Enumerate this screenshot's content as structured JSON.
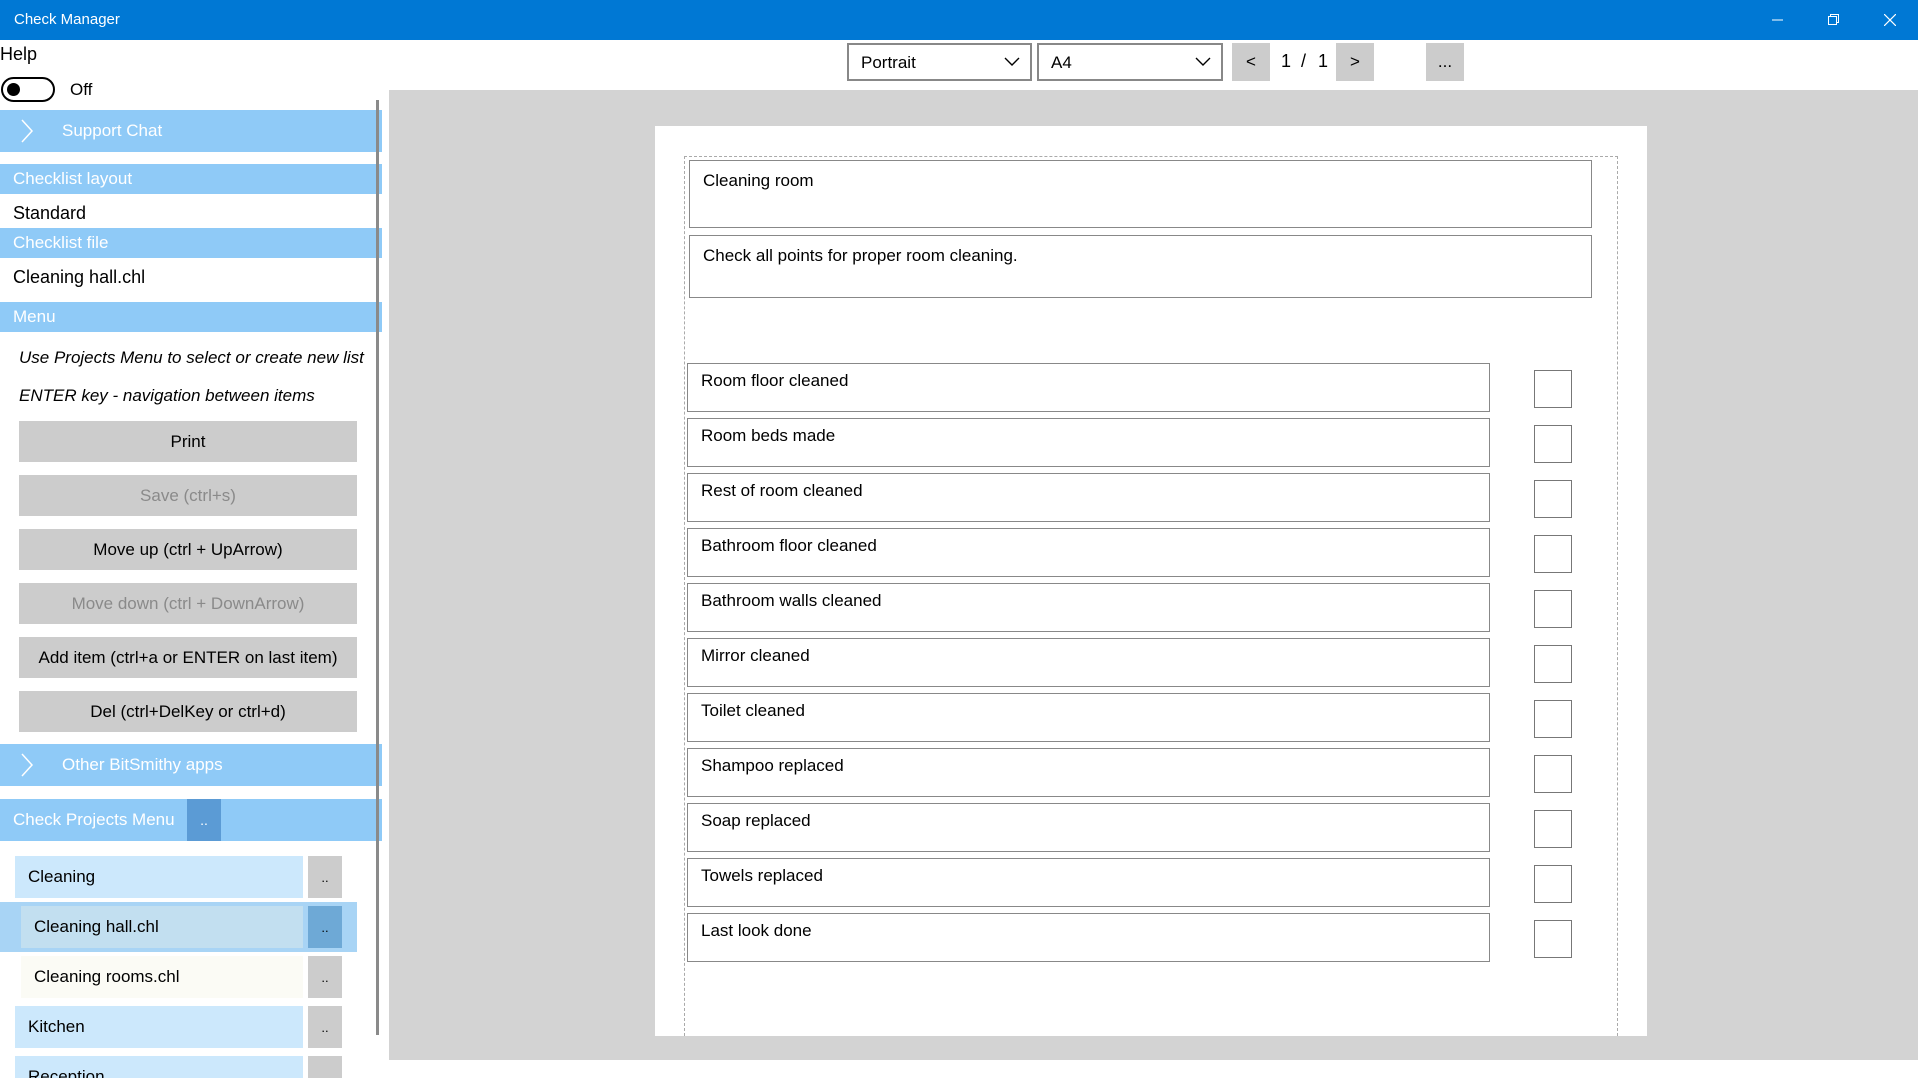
{
  "window": {
    "title": "Check Manager"
  },
  "left_panel": {
    "help_label": "Help",
    "help_toggle": {
      "state_label": "Off",
      "on": false
    },
    "support_chat_label": "Support Chat",
    "checklist_layout": {
      "header": "Checklist layout",
      "value": "Standard"
    },
    "checklist_file": {
      "header": "Checklist file",
      "value": "Cleaning hall.chl"
    },
    "menu": {
      "header": "Menu",
      "notes": [
        "Use Projects Menu to select or create new list",
        "ENTER key - navigation between items"
      ],
      "buttons": [
        {
          "label": "Print",
          "enabled": true
        },
        {
          "label": "Save (ctrl+s)",
          "enabled": false
        },
        {
          "label": "Move up (ctrl + UpArrow)",
          "enabled": true
        },
        {
          "label": "Move down (ctrl + DownArrow)",
          "enabled": false
        },
        {
          "label": "Add item (ctrl+a or ENTER on last item)",
          "enabled": true
        },
        {
          "label": "Del (ctrl+DelKey or ctrl+d)",
          "enabled": true
        }
      ]
    },
    "other_apps_label": "Other BitSmithy apps",
    "projects_menu": {
      "header": "Check Projects Menu",
      "dots": "..",
      "items": [
        {
          "label": "Cleaning",
          "dots": "..",
          "kind": "folder"
        },
        {
          "label": "Cleaning hall.chl",
          "dots": "..",
          "kind": "file",
          "selected": true
        },
        {
          "label": "Cleaning rooms.chl",
          "dots": "..",
          "kind": "file"
        },
        {
          "label": "Kitchen",
          "dots": "..",
          "kind": "folder"
        },
        {
          "label": "Reception",
          "dots": "..",
          "kind": "folder"
        }
      ]
    }
  },
  "toolbar": {
    "orientation": "Portrait",
    "paper_size": "A4",
    "prev_label": "<",
    "next_label": ">",
    "current_page": "1",
    "separator": "/",
    "total_pages": "1",
    "more_label": "..."
  },
  "checklist": {
    "title": "Cleaning room",
    "description": "Check all points for proper room cleaning.",
    "items": [
      {
        "text": "Room floor cleaned",
        "checked": false
      },
      {
        "text": "Room beds made",
        "checked": false
      },
      {
        "text": "Rest of room cleaned",
        "checked": false
      },
      {
        "text": "Bathroom floor cleaned",
        "checked": false
      },
      {
        "text": "Bathroom walls cleaned",
        "checked": false
      },
      {
        "text": "Mirror cleaned",
        "checked": false
      },
      {
        "text": "Toilet cleaned",
        "checked": false
      },
      {
        "text": "Shampoo replaced",
        "checked": false
      },
      {
        "text": "Soap replaced",
        "checked": false
      },
      {
        "text": "Towels replaced",
        "checked": false
      },
      {
        "text": "Last look done",
        "checked": false
      }
    ]
  },
  "colors": {
    "titlebar": "#0078d4",
    "band": "#8fcaf7",
    "selected_row": "#a8d4f5",
    "folder_row": "#cce8fc"
  }
}
